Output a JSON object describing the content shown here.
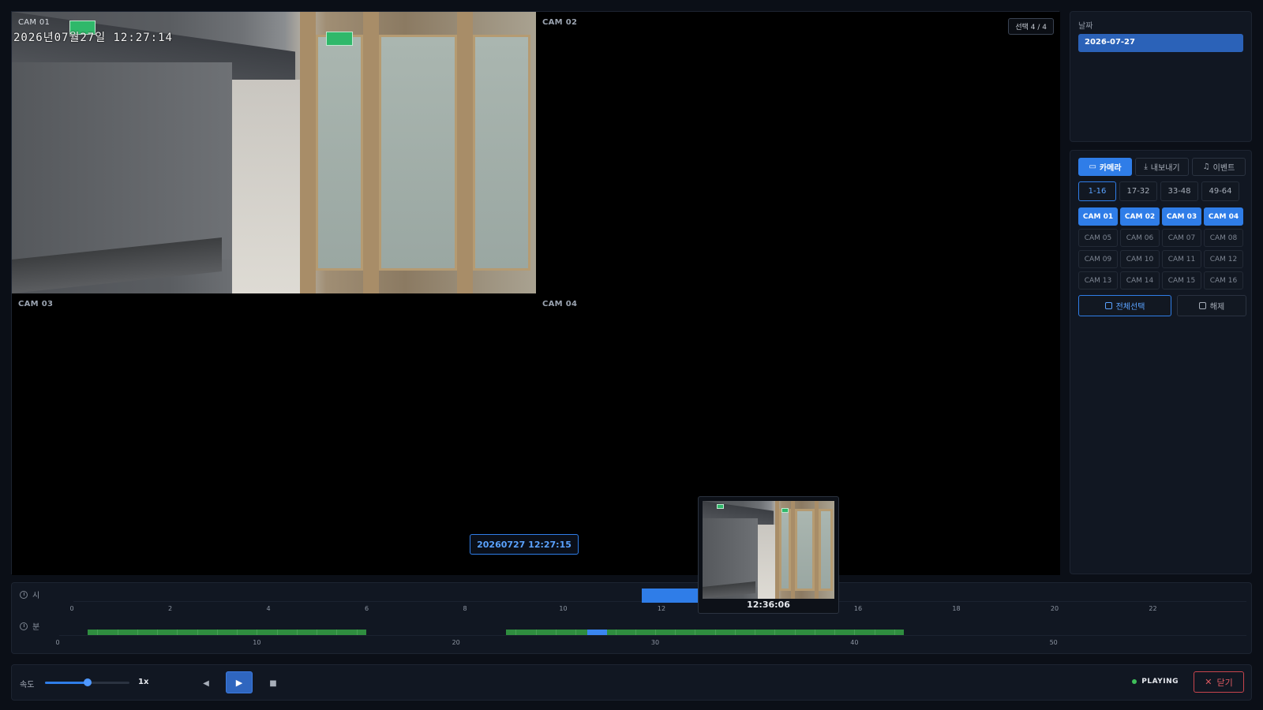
{
  "colors": {
    "accent": "#2f7de8",
    "recording": "#2f8d3f",
    "status_playing": "#3fbf5a",
    "close": "#e05a62"
  },
  "cams": {
    "cam01": {
      "label": "CAM 01",
      "osd": "2026년07월27일 12:27:14"
    },
    "cam02": {
      "label": "CAM 02"
    },
    "cam03": {
      "label": "CAM 03"
    },
    "cam04": {
      "label": "CAM 04"
    }
  },
  "selection_badge": "선택 4 / 4",
  "current_time": "20260727 12:27:15",
  "date_panel": {
    "label": "날짜",
    "value": "2026-07-27"
  },
  "tabs": [
    {
      "label": "카메라",
      "icon": "camera-icon",
      "active": true
    },
    {
      "label": "내보내기",
      "icon": "download-icon",
      "active": false
    },
    {
      "label": "이벤트",
      "icon": "bell-icon",
      "active": false
    }
  ],
  "ranges": [
    "1-16",
    "17-32",
    "33-48",
    "49-64"
  ],
  "active_range": "1-16",
  "camera_buttons": [
    "CAM 01",
    "CAM 02",
    "CAM 03",
    "CAM 04",
    "CAM 05",
    "CAM 06",
    "CAM 07",
    "CAM 08",
    "CAM 09",
    "CAM 10",
    "CAM 11",
    "CAM 12",
    "CAM 13",
    "CAM 14",
    "CAM 15",
    "CAM 16"
  ],
  "selected_cameras": [
    "CAM 01",
    "CAM 02",
    "CAM 03",
    "CAM 04"
  ],
  "actions": {
    "select_all": "전체선택",
    "deselect": "해제"
  },
  "timeline": {
    "hour_label": "시",
    "minute_label": "분",
    "hour_ticks": [
      "0",
      "2",
      "4",
      "6",
      "8",
      "10",
      "12",
      "14",
      "16",
      "18",
      "20",
      "22"
    ],
    "minute_ticks": [
      "0",
      "10",
      "20",
      "30",
      "40",
      "50"
    ],
    "hour_recorded": [
      [
        11.6,
        13.3
      ]
    ],
    "minute_recorded": [
      [
        1.5,
        15.5
      ],
      [
        22.5,
        42.5
      ]
    ],
    "minute_current": [
      26.6,
      27.6
    ],
    "preview_time": "12:36:06"
  },
  "controls": {
    "speed_label": "속도",
    "speed_value": "1x",
    "speed_fraction": 0.5,
    "status": "PLAYING",
    "close_label": "닫기"
  }
}
